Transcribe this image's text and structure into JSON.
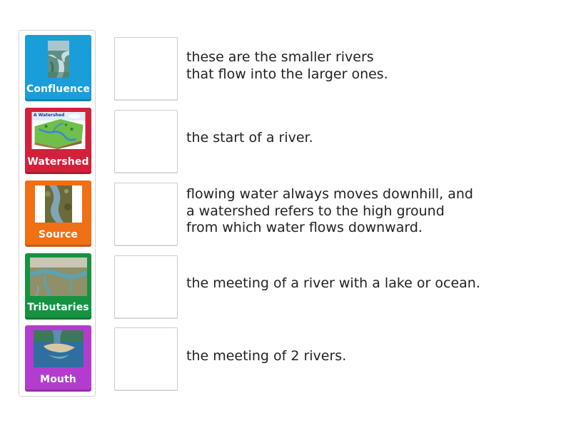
{
  "tiles": [
    {
      "label": "Confluence",
      "color": "#1a9ed9",
      "image": "confluence-photo"
    },
    {
      "label": "Watershed",
      "color": "#d4203a",
      "image": "watershed-diagram",
      "image_text": "A Watershed"
    },
    {
      "label": "Source",
      "color": "#f07016",
      "image": "source-photo"
    },
    {
      "label": "Tributaries",
      "color": "#159341",
      "image": "tributaries-aerial-photo"
    },
    {
      "label": "Mouth",
      "color": "#b33ccf",
      "image": "mouth-aerial-photo"
    }
  ],
  "definitions": [
    "these are the smaller rivers\nthat flow into the larger ones.",
    "the start of a river.",
    "flowing water always moves downhill, and\na watershed refers to the high ground\nfrom which water flows downward.",
    "the meeting of a river with a lake or ocean.",
    "the meeting of 2 rivers."
  ]
}
